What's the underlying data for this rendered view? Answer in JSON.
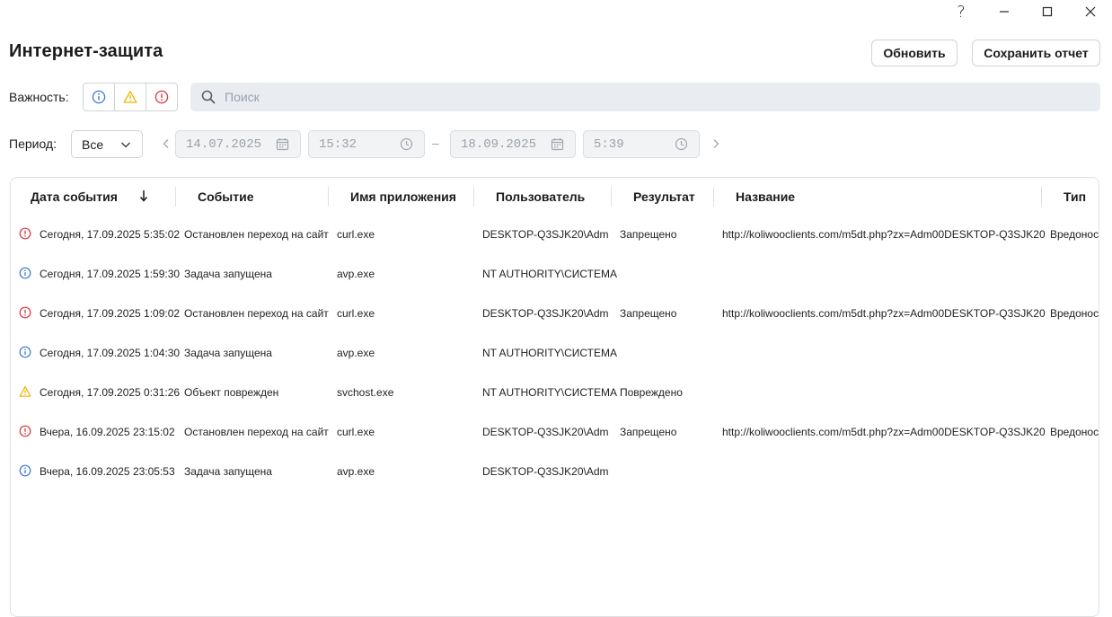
{
  "window": {
    "help": "?"
  },
  "header": {
    "title": "Интернет-защита",
    "refresh_label": "Обновить",
    "save_label": "Сохранить отчет"
  },
  "filters": {
    "severity_label": "Важность:",
    "search_placeholder": "Поиск",
    "period_label": "Период:",
    "period_value": "Все",
    "date_from": "14.07.2025",
    "time_from": "15:32",
    "separator": "–",
    "date_to": "18.09.2025",
    "time_to": "5:39"
  },
  "colors": {
    "info": "#3b78d6",
    "warning": "#f0b400",
    "error": "#d9363e"
  },
  "table": {
    "headers": {
      "date": "Дата события",
      "event": "Событие",
      "app": "Имя приложения",
      "user": "Пользователь",
      "result": "Результат",
      "name": "Название",
      "type": "Тип"
    },
    "rows": [
      {
        "severity": "error",
        "date": "Сегодня, 17.09.2025 5:35:02",
        "event": "Остановлен переход на сайт",
        "app": "curl.exe",
        "user": "DESKTOP-Q3SJK20\\Adm",
        "result": "Запрещено",
        "name": "http://koliwooclients.com/m5dt.php?zx=Adm00DESKTOP-Q3SJK20",
        "type": "Вредоносн"
      },
      {
        "severity": "info",
        "date": "Сегодня, 17.09.2025 1:59:30",
        "event": "Задача запущена",
        "app": "avp.exe",
        "user": "NT AUTHORITY\\СИСТЕМА",
        "result": "",
        "name": "",
        "type": ""
      },
      {
        "severity": "error",
        "date": "Сегодня, 17.09.2025 1:09:02",
        "event": "Остановлен переход на сайт",
        "app": "curl.exe",
        "user": "DESKTOP-Q3SJK20\\Adm",
        "result": "Запрещено",
        "name": "http://koliwooclients.com/m5dt.php?zx=Adm00DESKTOP-Q3SJK20",
        "type": "Вредоносн"
      },
      {
        "severity": "info",
        "date": "Сегодня, 17.09.2025 1:04:30",
        "event": "Задача запущена",
        "app": "avp.exe",
        "user": "NT AUTHORITY\\СИСТЕМА",
        "result": "",
        "name": "",
        "type": ""
      },
      {
        "severity": "warning",
        "date": "Сегодня, 17.09.2025 0:31:26",
        "event": "Объект поврежден",
        "app": "svchost.exe",
        "user": "NT AUTHORITY\\СИСТЕМА",
        "result": "Повреждено",
        "name": "",
        "type": ""
      },
      {
        "severity": "error",
        "date": "Вчера, 16.09.2025 23:15:02",
        "event": "Остановлен переход на сайт",
        "app": "curl.exe",
        "user": "DESKTOP-Q3SJK20\\Adm",
        "result": "Запрещено",
        "name": "http://koliwooclients.com/m5dt.php?zx=Adm00DESKTOP-Q3SJK20",
        "type": "Вредоносн"
      },
      {
        "severity": "info",
        "date": "Вчера, 16.09.2025 23:05:53",
        "event": "Задача запущена",
        "app": "avp.exe",
        "user": "DESKTOP-Q3SJK20\\Adm",
        "result": "",
        "name": "",
        "type": ""
      }
    ]
  }
}
